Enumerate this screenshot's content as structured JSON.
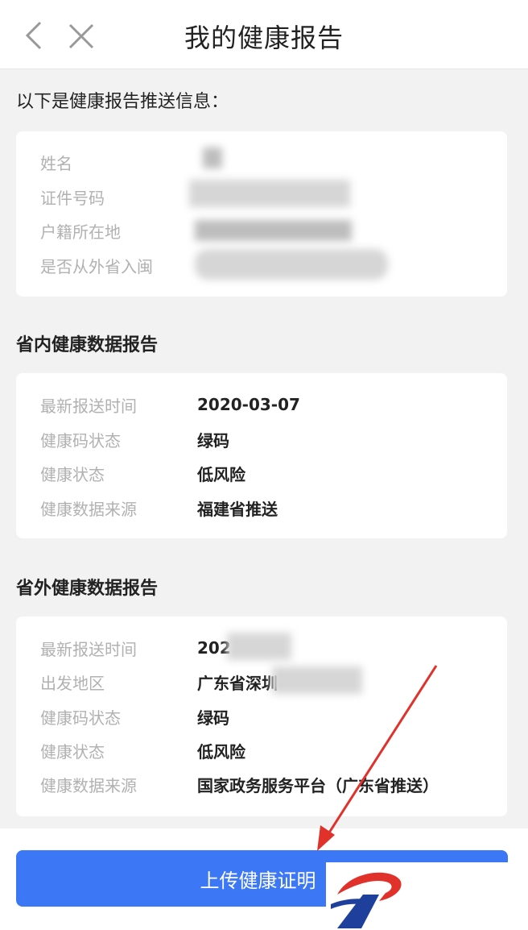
{
  "nav": {
    "title": "我的健康报告",
    "back_icon": "chevron-left-icon",
    "close_icon": "close-icon"
  },
  "intro": "以下是健康报告推送信息：",
  "personal": {
    "rows": [
      {
        "label": "姓名",
        "value": ""
      },
      {
        "label": "证件号码",
        "value": ""
      },
      {
        "label": "户籍所在地",
        "value": ""
      },
      {
        "label": "是否从外省入闽",
        "value": ""
      }
    ]
  },
  "province_report": {
    "title": "省内健康数据报告",
    "rows": [
      {
        "label": "最新报送时间",
        "value": "2020-03-07"
      },
      {
        "label": "健康码状态",
        "value": "绿码"
      },
      {
        "label": "健康状态",
        "value": "低风险"
      },
      {
        "label": "健康数据来源",
        "value": "福建省推送"
      }
    ]
  },
  "outside_report": {
    "title": "省外健康数据报告",
    "rows": [
      {
        "label": "最新报送时间",
        "value": "202"
      },
      {
        "label": "出发地区",
        "value": "广东省深圳"
      },
      {
        "label": "健康码状态",
        "value": "绿码"
      },
      {
        "label": "健康状态",
        "value": "低风险"
      },
      {
        "label": "健康数据来源",
        "value": "国家政务服务平台（广东省推送）"
      }
    ]
  },
  "upload_button": "上传健康证明",
  "colors": {
    "primary": "#3c78f5",
    "arrow": "#e0322a",
    "logo_red": "#e0322a",
    "logo_blue": "#1f3f9c"
  }
}
